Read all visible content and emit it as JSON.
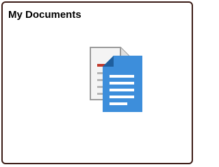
{
  "tile": {
    "title": "My Documents",
    "icon": "documents-icon"
  },
  "colors": {
    "tile_border": "#3a1a14",
    "doc_back_fill": "#f4f4f4",
    "doc_back_border": "#9a9a9a",
    "doc_back_accent": "#c0392b",
    "doc_front_fill": "#3d8edb",
    "doc_front_corner": "#1f5f9e",
    "doc_front_lines": "#ffffff"
  }
}
